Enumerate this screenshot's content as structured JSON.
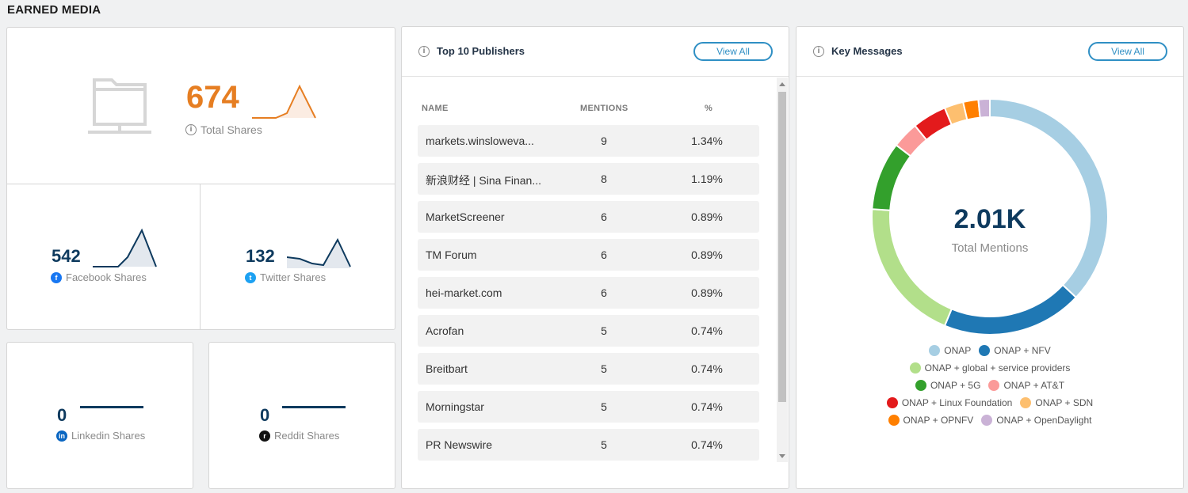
{
  "section_title": "EARNED MEDIA",
  "total_shares": {
    "value": "674",
    "label": "Total Shares",
    "color": "#e67e22"
  },
  "facebook": {
    "value": "542",
    "label": "Facebook Shares"
  },
  "twitter": {
    "value": "132",
    "label": "Twitter Shares"
  },
  "linkedin": {
    "value": "0",
    "label": "Linkedin Shares"
  },
  "reddit": {
    "value": "0",
    "label": "Reddit Shares"
  },
  "publishers": {
    "title": "Top 10 Publishers",
    "view_all": "View All",
    "columns": [
      "NAME",
      "MENTIONS",
      "%"
    ],
    "rows": [
      {
        "name": "markets.winsloweva...",
        "mentions": "9",
        "pct": "1.34%"
      },
      {
        "name": "新浪财经 | Sina Finan...",
        "mentions": "8",
        "pct": "1.19%"
      },
      {
        "name": "MarketScreener",
        "mentions": "6",
        "pct": "0.89%"
      },
      {
        "name": "TM Forum",
        "mentions": "6",
        "pct": "0.89%"
      },
      {
        "name": "hei-market.com",
        "mentions": "6",
        "pct": "0.89%"
      },
      {
        "name": "Acrofan",
        "mentions": "5",
        "pct": "0.74%"
      },
      {
        "name": "Breitbart",
        "mentions": "5",
        "pct": "0.74%"
      },
      {
        "name": "Morningstar",
        "mentions": "5",
        "pct": "0.74%"
      },
      {
        "name": "PR Newswire",
        "mentions": "5",
        "pct": "0.74%"
      }
    ]
  },
  "key_messages": {
    "title": "Key Messages",
    "view_all": "View All",
    "center_value": "2.01K",
    "center_label": "Total Mentions",
    "legend": [
      {
        "label": "ONAP",
        "color": "#a6cee3"
      },
      {
        "label": "ONAP + NFV",
        "color": "#1f78b4"
      },
      {
        "label": "ONAP + global + service providers",
        "color": "#b2df8a"
      },
      {
        "label": "ONAP + 5G",
        "color": "#33a02c"
      },
      {
        "label": "ONAP + AT&T",
        "color": "#fb9a99"
      },
      {
        "label": "ONAP + Linux Foundation",
        "color": "#e31a1c"
      },
      {
        "label": "ONAP + SDN",
        "color": "#fdbf6f"
      },
      {
        "label": "ONAP + OPNFV",
        "color": "#ff7f00"
      },
      {
        "label": "ONAP + OpenDaylight",
        "color": "#cab2d6"
      }
    ]
  },
  "chart_data": {
    "type": "pie",
    "title": "",
    "center_text": "2.01K",
    "categories": [
      "ONAP",
      "ONAP + NFV",
      "ONAP + global + service providers",
      "ONAP + 5G",
      "ONAP + AT&T",
      "ONAP + Linux Foundation",
      "ONAP + SDN",
      "ONAP + OPNFV",
      "ONAP + OpenDaylight"
    ],
    "values": [
      35.5,
      18.5,
      19,
      9,
      3.5,
      4.5,
      2.5,
      2,
      1.5
    ],
    "legend_position": "bottom"
  }
}
